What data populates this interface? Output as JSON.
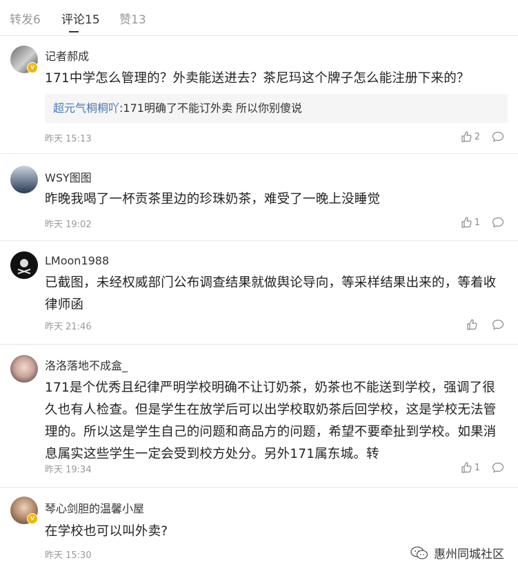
{
  "tabs": [
    {
      "label": "转发6"
    },
    {
      "label": "评论15"
    },
    {
      "label": "赞13"
    }
  ],
  "comments": [
    {
      "user": "记者郝成",
      "verified": true,
      "text": "171中学怎么管理的？外卖能送进去？茶尼玛这个牌子怎么能注册下来的？",
      "reply_user": "超元气桐桐吖",
      "reply_text": ":171明确了不能订外卖 所以你别傻说",
      "time": "昨天 15:13",
      "likes": "2"
    },
    {
      "user": "WSY图图",
      "verified": false,
      "text": "昨晚我喝了一杯贡茶里边的珍珠奶茶，难受了一晚上没睡觉",
      "time": "昨天 19:02",
      "likes": "1"
    },
    {
      "user": "LMoon1988",
      "verified": false,
      "text": "已截图，未经权威部门公布调查结果就做舆论导向，等采样结果出来的，等着收律师函",
      "time": "昨天 21:46",
      "likes": ""
    },
    {
      "user": "洛洛落地不成盒_",
      "verified": false,
      "text": "171是个优秀且纪律严明学校明确不让订奶茶，奶茶也不能送到学校，强调了很久也有人检查。但是学生在放学后可以出学校取奶茶后回学校，这是学校无法管理的。所以这是学生自己的问题和商品方的问题，希望不要牵扯到学校。如果消息属实这些学生一定会受到校方处分。另外171属东城。转",
      "time": "昨天 19:34",
      "likes": "1"
    },
    {
      "user": "琴心剑胆的温馨小屋",
      "verified": true,
      "text": "在学校也可以叫外卖?",
      "time": "昨天 15:30",
      "likes": ""
    }
  ],
  "watermark": "惠州同城社区",
  "colors": {
    "accent_link": "#4a78b5",
    "verified_badge": "#f7b500",
    "muted": "#999999"
  }
}
